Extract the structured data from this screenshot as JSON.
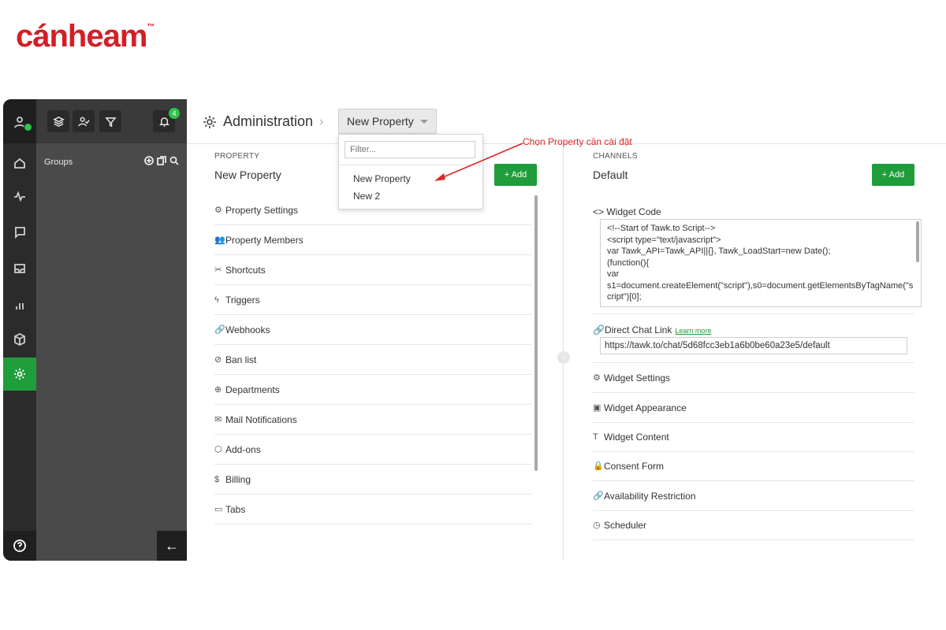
{
  "brand": {
    "logo_text": "cánheam",
    "trademark": "™",
    "color": "#d21f26"
  },
  "sidebar": {
    "notification_count": "4",
    "groups_label": "Groups",
    "accent": "#1f9d3b"
  },
  "header": {
    "title": "Administration",
    "selected_property": "New Property"
  },
  "dropdown": {
    "filter_placeholder": "Filter...",
    "options": [
      "New Property",
      "New 2"
    ]
  },
  "annotation": {
    "text": "Chọn Property cần cài đặt",
    "color": "#e02424"
  },
  "property": {
    "section_label": "PROPERTY",
    "name": "New Property",
    "add_label": "+ Add",
    "items": [
      {
        "icon": "⚙",
        "label": "Property Settings"
      },
      {
        "icon": "👥",
        "label": "Property Members"
      },
      {
        "icon": "✂",
        "label": "Shortcuts"
      },
      {
        "icon": "ϟ",
        "label": "Triggers"
      },
      {
        "icon": "🔗",
        "label": "Webhooks"
      },
      {
        "icon": "⊘",
        "label": "Ban list"
      },
      {
        "icon": "⊕",
        "label": "Departments"
      },
      {
        "icon": "✉",
        "label": "Mail Notifications"
      },
      {
        "icon": "⬡",
        "label": "Add-ons"
      },
      {
        "icon": "$",
        "label": "Billing"
      },
      {
        "icon": "▭",
        "label": "Tabs"
      }
    ]
  },
  "channels": {
    "section_label": "CHANNELS",
    "name": "Default",
    "add_label": "+ Add",
    "widget_code_label": "Widget Code",
    "widget_code": "<!--Start of Tawk.to Script-->\n<script type=\"text/javascript\">\nvar Tawk_API=Tawk_API||{}, Tawk_LoadStart=new Date();\n(function(){\nvar\ns1=document.createElement(\"script\"),s0=document.getElementsByTagName(\"script\")[0];",
    "direct_link_label": "Direct Chat Link",
    "learn_more": "Learn more",
    "direct_link": "https://tawk.to/chat/5d68fcc3eb1a6b0be60a23e5/default",
    "items": [
      {
        "icon": "⚙",
        "label": "Widget Settings"
      },
      {
        "icon": "▣",
        "label": "Widget Appearance"
      },
      {
        "icon": "T",
        "label": "Widget Content"
      },
      {
        "icon": "🔒",
        "label": "Consent Form"
      },
      {
        "icon": "🔗",
        "label": "Availability Restriction"
      },
      {
        "icon": "◷",
        "label": "Scheduler"
      }
    ]
  }
}
